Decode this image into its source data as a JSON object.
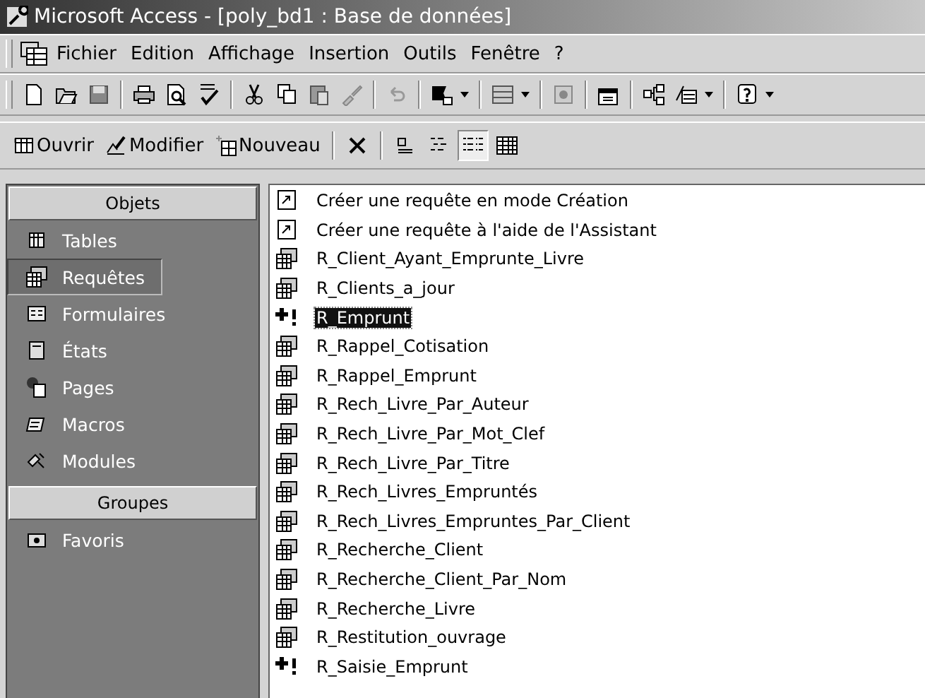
{
  "window": {
    "title": "Microsoft Access - [poly_bd1 : Base de données]"
  },
  "menu": [
    "Fichier",
    "Edition",
    "Affichage",
    "Insertion",
    "Outils",
    "Fenêtre",
    "?"
  ],
  "db_toolbar": {
    "buttons": [
      "Ouvrir",
      "Modifier",
      "Nouveau"
    ],
    "views": [
      {
        "selected": false
      },
      {
        "selected": false
      },
      {
        "selected": true
      },
      {
        "selected": false
      }
    ]
  },
  "sidebar": {
    "sections": [
      {
        "title": "Objets",
        "items": [
          {
            "label": "Tables",
            "kind": "tables",
            "selected": false
          },
          {
            "label": "Requêtes",
            "kind": "queries",
            "selected": true
          },
          {
            "label": "Formulaires",
            "kind": "forms",
            "selected": false
          },
          {
            "label": "États",
            "kind": "reports",
            "selected": false
          },
          {
            "label": "Pages",
            "kind": "pages",
            "selected": false
          },
          {
            "label": "Macros",
            "kind": "macros",
            "selected": false
          },
          {
            "label": "Modules",
            "kind": "modules",
            "selected": false
          }
        ]
      },
      {
        "title": "Groupes",
        "items": [
          {
            "label": "Favoris",
            "kind": "favorites",
            "selected": false
          }
        ]
      }
    ]
  },
  "list": [
    {
      "label": "Créer une requête en mode Création",
      "kind": "shortcut",
      "selected": false
    },
    {
      "label": "Créer une requête à l'aide de l'Assistant",
      "kind": "shortcut",
      "selected": false
    },
    {
      "label": "R_Client_Ayant_Emprunte_Livre",
      "kind": "select",
      "selected": false
    },
    {
      "label": "R_Clients_a_jour",
      "kind": "select",
      "selected": false
    },
    {
      "label": "R_Emprunt",
      "kind": "append",
      "selected": true
    },
    {
      "label": "R_Rappel_Cotisation",
      "kind": "select",
      "selected": false
    },
    {
      "label": "R_Rappel_Emprunt",
      "kind": "select",
      "selected": false
    },
    {
      "label": "R_Rech_Livre_Par_Auteur",
      "kind": "select",
      "selected": false
    },
    {
      "label": "R_Rech_Livre_Par_Mot_Clef",
      "kind": "select",
      "selected": false
    },
    {
      "label": "R_Rech_Livre_Par_Titre",
      "kind": "select",
      "selected": false
    },
    {
      "label": "R_Rech_Livres_Empruntés",
      "kind": "select",
      "selected": false
    },
    {
      "label": "R_Rech_Livres_Empruntes_Par_Client",
      "kind": "select",
      "selected": false
    },
    {
      "label": "R_Recherche_Client",
      "kind": "select",
      "selected": false
    },
    {
      "label": "R_Recherche_Client_Par_Nom",
      "kind": "select",
      "selected": false
    },
    {
      "label": "R_Recherche_Livre",
      "kind": "select",
      "selected": false
    },
    {
      "label": "R_Restitution_ouvrage",
      "kind": "select",
      "selected": false
    },
    {
      "label": "R_Saisie_Emprunt",
      "kind": "append",
      "selected": false
    }
  ]
}
